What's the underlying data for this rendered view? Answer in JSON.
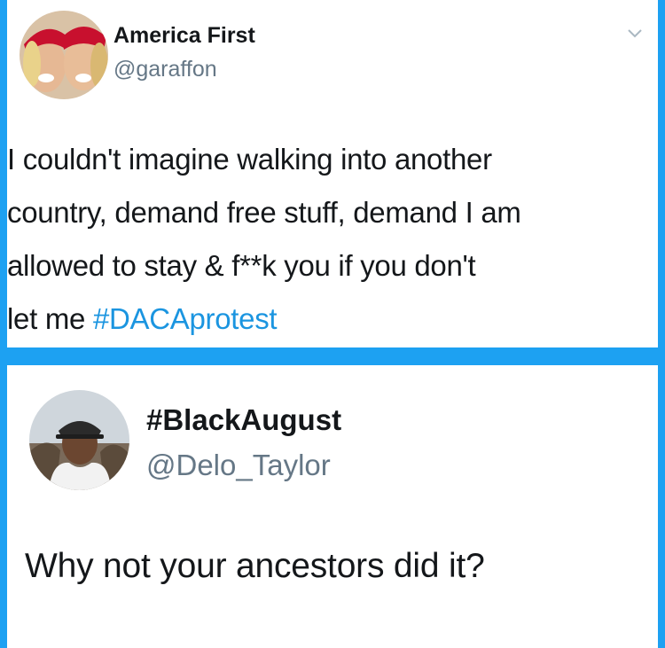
{
  "tweets": [
    {
      "display_name": "America First",
      "handle": "@garaffon",
      "text_lines": [
        "I couldn't imagine walking into another",
        "country, demand free stuff, demand I am",
        "allowed to stay &  f**k you if you don't",
        "let me "
      ],
      "hashtag": "#DACAprotest",
      "avatar_icon": "two-women-red-caps-avatar",
      "menu_icon": "chevron-down-icon"
    },
    {
      "display_name": "#BlackAugust",
      "handle": "@Delo_Taylor",
      "text": "Why not your ancestors did it?",
      "avatar_icon": "man-with-cap-avatar"
    }
  ],
  "colors": {
    "background": "#1da1f2",
    "card": "#ffffff",
    "text": "#14171a",
    "handle": "#657786",
    "hashtag": "#1b95e0"
  }
}
